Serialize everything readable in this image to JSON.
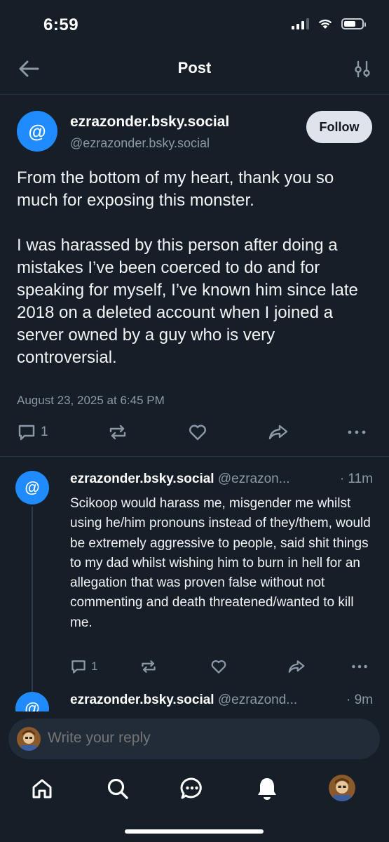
{
  "status_bar": {
    "time": "6:59"
  },
  "header": {
    "title": "Post"
  },
  "main_post": {
    "avatar_symbol": "@",
    "display_name": "ezrazonder.bsky.social",
    "handle": "@ezrazonder.bsky.social",
    "follow_label": "Follow",
    "paragraphs": [
      "From the bottom of my heart, thank you so much for exposing this monster.",
      "I was harassed by this person after doing a mistakes I’ve been coerced to do and for speaking for myself, I’ve known him since late 2018 on a deleted account when I joined a server owned by a guy who is very controversial."
    ],
    "date": "August 23, 2025 at 6:45 PM",
    "reply_count": "1"
  },
  "replies": [
    {
      "avatar_symbol": "@",
      "display_name": "ezrazonder.bsky.social",
      "handle": "@ezrazon...",
      "time": "· 11m",
      "text": "Scikoop would harass me, misgender me whilst using he/him pronouns instead of they/them, would be extremely aggressive to people, said shit things to my dad whilst wishing him to burn in hell for an allegation that was proven false without not commenting and death threatened/wanted to kill me.",
      "reply_count": "1"
    },
    {
      "avatar_symbol": "@",
      "display_name": "ezrazonder.bsky.social",
      "handle": "@ezrazond...",
      "time": "· 9m"
    }
  ],
  "composer": {
    "placeholder": "Write your reply"
  },
  "tab_bar": {
    "items": [
      "home-icon",
      "search-icon",
      "chat-icon",
      "bell-icon",
      "profile-avatar"
    ]
  },
  "colors": {
    "background": "#161e27",
    "accent": "#208bfe",
    "muted": "#8d98a5"
  }
}
